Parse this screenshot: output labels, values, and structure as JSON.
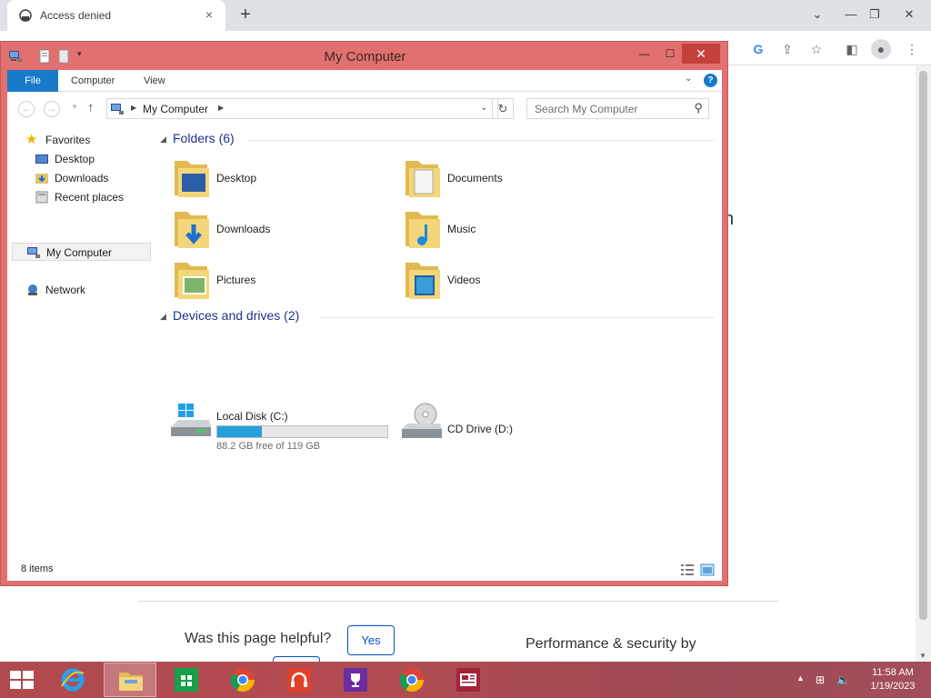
{
  "browser": {
    "tab_title": "Access denied",
    "tab_close_icon": "×",
    "new_tab_icon": "+",
    "page_partial_text": "n",
    "helpful_question": "Was this page helpful?",
    "yes_label": "Yes",
    "performance_text": "Performance & security by"
  },
  "explorer": {
    "title": "My Computer",
    "ribbon": {
      "file": "File",
      "tabs": [
        "Computer",
        "View"
      ],
      "help": "?"
    },
    "address": {
      "crumb": "My Computer",
      "search_placeholder": "Search My Computer"
    },
    "nav": {
      "favorites": "Favorites",
      "desktop": "Desktop",
      "downloads": "Downloads",
      "recent": "Recent places",
      "my_computer": "My Computer",
      "network": "Network"
    },
    "groups": {
      "folders": "Folders (6)",
      "drives": "Devices and drives (2)"
    },
    "folders": [
      "Desktop",
      "Documents",
      "Downloads",
      "Music",
      "Pictures",
      "Videos"
    ],
    "drives": {
      "c_label": "Local Disk (C:)",
      "c_free_text": "88.2 GB free of 119 GB",
      "c_used_fraction": 0.26,
      "d_label": "CD Drive (D:)"
    },
    "status": "8 items"
  },
  "taskbar": {
    "time": "11:58 AM",
    "date": "1/19/2023"
  },
  "colors": {
    "window_frame": "#e2706e",
    "file_tab": "#1979ca",
    "drive_fill": "#26a0da",
    "close_button": "#c4403d"
  }
}
